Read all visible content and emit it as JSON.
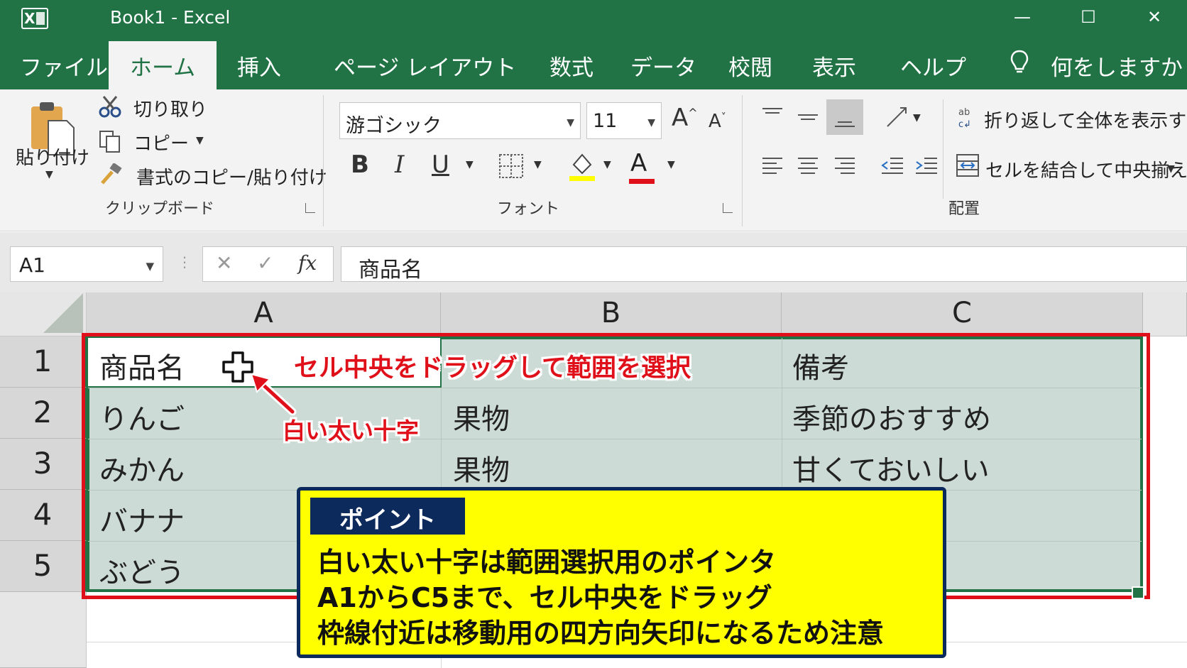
{
  "window": {
    "title": "Book1  -  Excel",
    "app_icon": "excel-icon",
    "minimize": "—",
    "maximize": "☐",
    "close": "✕"
  },
  "tabs": [
    "ファイル",
    "ホーム",
    "挿入",
    "ページ レイアウト",
    "数式",
    "データ",
    "校閲",
    "表示",
    "ヘルプ"
  ],
  "tell_me": "何をしますか",
  "clipboard": {
    "paste": "貼り付け",
    "cut": "切り取り",
    "copy": "コピー",
    "format_painter": "書式のコピー/貼り付け",
    "group_label": "クリップボード"
  },
  "font": {
    "family": "游ゴシック",
    "size": "11",
    "grow": "A",
    "shrink": "A",
    "bold": "B",
    "italic": "I",
    "underline": "U",
    "font_color": "A",
    "group_label": "フォント",
    "fill_color": "#ffff00",
    "text_color": "#e0101a"
  },
  "alignment": {
    "wrap_text": "折り返して全体を表示する",
    "merge_center": "セルを結合して中央揃え",
    "group_label": "配置"
  },
  "formula_bar": {
    "name_box": "A1",
    "cancel": "✕",
    "enter": "✓",
    "fx": "fx",
    "content": "商品名"
  },
  "sheet": {
    "columns": [
      "A",
      "B",
      "C"
    ],
    "rows": [
      "1",
      "2",
      "3",
      "4",
      "5"
    ],
    "cells": [
      [
        "商品名",
        "",
        "備考"
      ],
      [
        "りんご",
        "果物",
        "季節のおすすめ"
      ],
      [
        "みかん",
        "果物",
        "甘くておいしい"
      ],
      [
        "バナナ",
        "",
        ""
      ],
      [
        "ぶどう",
        "",
        ""
      ]
    ]
  },
  "annotations": {
    "drag_text": "セル中央をドラッグして範囲を選択",
    "cross_label": "白い太い十字",
    "accent_color": "#e0101a"
  },
  "point_box": {
    "badge": "ポイント",
    "lines": [
      "白い太い十字は範囲選択用のポインタ",
      "A1からC5まで、セル中央をドラッグ",
      "枠線付近は移動用の四方向矢印になるため注意"
    ]
  },
  "colors": {
    "excel_green": "#217346",
    "selection_fill": "#ccdbd5",
    "point_bg": "#ffff00",
    "point_border": "#0d2a5c"
  }
}
